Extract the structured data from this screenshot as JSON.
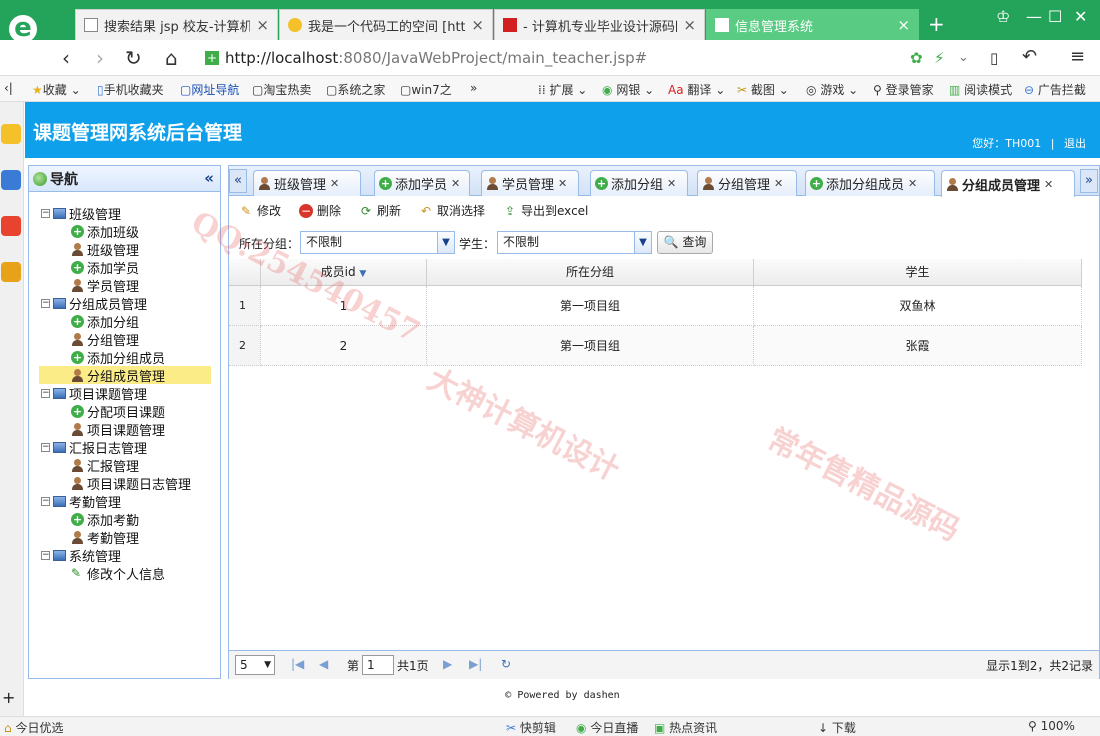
{
  "browser": {
    "tabs": [
      {
        "title": "搜索结果 jsp 校友-计算机毕…",
        "active": false
      },
      {
        "title": "我是一个代码工的空间 [http…",
        "active": false
      },
      {
        "title": "- 计算机专业毕业设计源码网",
        "active": false
      },
      {
        "title": "信息管理系统",
        "active": true
      }
    ],
    "new_tab": "+",
    "url_host": "http://localhost",
    "url_rest": ":8080/JavaWebProject/main_teacher.jsp#",
    "bookmarks": [
      "收藏",
      "手机收藏夹",
      "网址导航",
      "淘宝热卖",
      "系统之家",
      "win7之",
      "»"
    ],
    "extensions": [
      "扩展",
      "网银",
      "翻译",
      "截图",
      "游戏",
      "登录管家",
      "阅读模式",
      "广告拦截"
    ],
    "status": {
      "left": "今日优选",
      "items": [
        "快剪辑",
        "今日直播",
        "热点资讯",
        "下载"
      ],
      "zoom": "100%"
    }
  },
  "app": {
    "title": "课题管理网系统后台管理",
    "user": "您好：TH001",
    "logout": "退出",
    "separator": "|",
    "nav": {
      "title": "导航",
      "collapse": "«",
      "groups": [
        {
          "label": "班级管理",
          "items": [
            {
              "label": "添加班级",
              "icon": "add"
            },
            {
              "label": "班级管理",
              "icon": "user"
            },
            {
              "label": "添加学员",
              "icon": "add"
            },
            {
              "label": "学员管理",
              "icon": "user"
            }
          ]
        },
        {
          "label": "分组成员管理",
          "items": [
            {
              "label": "添加分组",
              "icon": "add"
            },
            {
              "label": "分组管理",
              "icon": "user"
            },
            {
              "label": "添加分组成员",
              "icon": "add"
            },
            {
              "label": "分组成员管理",
              "icon": "user",
              "selected": true
            }
          ]
        },
        {
          "label": "项目课题管理",
          "items": [
            {
              "label": "分配项目课题",
              "icon": "add"
            },
            {
              "label": "项目课题管理",
              "icon": "user"
            }
          ]
        },
        {
          "label": "汇报日志管理",
          "items": [
            {
              "label": "汇报管理",
              "icon": "user"
            },
            {
              "label": "项目课题日志管理",
              "icon": "user"
            }
          ]
        },
        {
          "label": "考勤管理",
          "items": [
            {
              "label": "添加考勤",
              "icon": "add"
            },
            {
              "label": "考勤管理",
              "icon": "user"
            }
          ]
        },
        {
          "label": "系统管理",
          "items": [
            {
              "label": "修改个人信息",
              "icon": "edit"
            }
          ]
        }
      ]
    },
    "panel_tabs": [
      {
        "label": "班级管理",
        "icon": "user"
      },
      {
        "label": "添加学员",
        "icon": "add"
      },
      {
        "label": "学员管理",
        "icon": "user"
      },
      {
        "label": "添加分组",
        "icon": "add"
      },
      {
        "label": "分组管理",
        "icon": "user"
      },
      {
        "label": "添加分组成员",
        "icon": "add"
      },
      {
        "label": "分组成员管理",
        "icon": "user",
        "active": true
      }
    ],
    "toolbar": {
      "edit": "修改",
      "delete": "删除",
      "refresh": "刷新",
      "unselect": "取消选择",
      "export": "导出到excel"
    },
    "filter": {
      "group_label": "所在分组：",
      "group_value": "不限制",
      "student_label": "学生：",
      "student_value": "不限制",
      "search": "查询"
    },
    "grid": {
      "columns": [
        "成员id",
        "所在分组",
        "学生"
      ],
      "rows": [
        {
          "num": "1",
          "id": "1",
          "group": "第一项目组",
          "student": "双鱼林"
        },
        {
          "num": "2",
          "id": "2",
          "group": "第一项目组",
          "student": "张霞"
        }
      ]
    },
    "pager": {
      "page_size": "5",
      "page_prefix": "第",
      "page": "1",
      "total_pages": "共1页",
      "summary": "显示1到2，共2记录"
    },
    "footer": "© Powered by dashen"
  },
  "watermark": [
    "QQ:254540457",
    "大神计算机设计",
    "常年售精品源码"
  ],
  "colors": {
    "header": "#0ea0ea",
    "browser_tabbar": "#24a35a",
    "selection": "#fbec88",
    "border": "#99bbe8"
  }
}
